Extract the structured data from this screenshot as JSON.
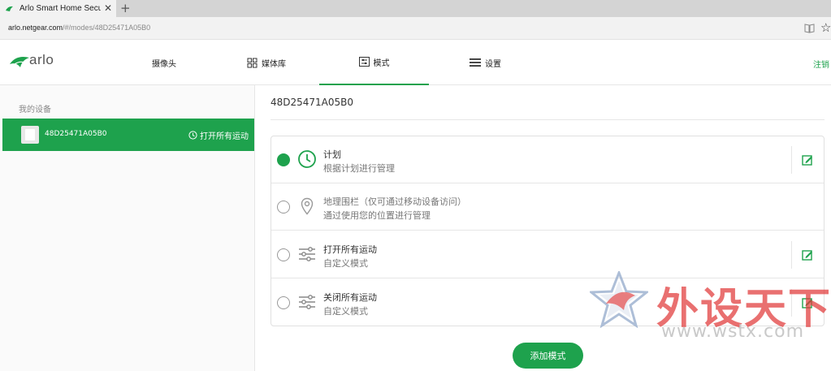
{
  "browser": {
    "tab_title": "Arlo Smart Home Secur",
    "url_host": "arlo.netgear.com",
    "url_path": "/#/modes/48D25471A05B0"
  },
  "header": {
    "logo_text": "arlo",
    "nav": [
      {
        "label": "摄像头",
        "icon": "camera"
      },
      {
        "label": "媒体库",
        "icon": "grid-icon"
      },
      {
        "label": "模式",
        "icon": "sliders-icon",
        "active": true
      },
      {
        "label": "设置",
        "icon": "menu-icon"
      }
    ],
    "logout": "注销"
  },
  "sidebar": {
    "title": "我的设备",
    "device": {
      "name": "48D25471A05B0",
      "mode": "打开所有运动"
    }
  },
  "main": {
    "device_title": "48D25471A05B0",
    "modes": [
      {
        "name": "计划",
        "desc": "根据计划进行管理",
        "selected": true,
        "editable": true,
        "icon": "clock-icon"
      },
      {
        "name": "地理围栏（仅可通过移动设备访问）",
        "desc": "通过使用您的位置进行管理",
        "selected": false,
        "editable": false,
        "icon": "location-pin-icon"
      },
      {
        "name": "打开所有运动",
        "desc": "自定义模式",
        "selected": false,
        "editable": true,
        "icon": "sliders-icon"
      },
      {
        "name": "关闭所有运动",
        "desc": "自定义模式",
        "selected": false,
        "editable": true,
        "icon": "sliders-icon"
      }
    ],
    "add_button": "添加模式"
  },
  "watermark": {
    "text": "外设天下",
    "url": "www.wstx.com"
  },
  "colors": {
    "accent": "#1ea24d",
    "watermark": "#e13a3a"
  }
}
